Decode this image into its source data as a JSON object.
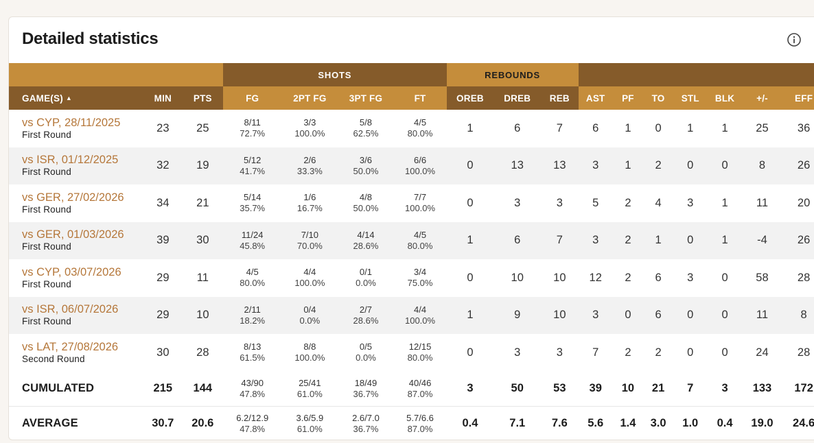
{
  "title": "Detailed statistics",
  "icons": {
    "info": "info-circle-icon",
    "sort": "sort-ascending-caret"
  },
  "colors": {
    "gold": "#c58d3b",
    "brown": "#855b2a",
    "link": "#b5773a"
  },
  "groups": {
    "shots": "SHOTS",
    "rebounds": "REBOUNDS"
  },
  "columns": {
    "game": "GAME(S)",
    "min": "MIN",
    "pts": "PTS",
    "fg": "FG",
    "fg2": "2PT FG",
    "fg3": "3PT FG",
    "ft": "FT",
    "oreb": "OREB",
    "dreb": "DREB",
    "reb": "REB",
    "ast": "AST",
    "pf": "PF",
    "to": "TO",
    "stl": "STL",
    "blk": "BLK",
    "pm": "+/-",
    "eff": "EFF"
  },
  "games": [
    {
      "game": "vs CYP, 28/11/2025",
      "round": "First Round",
      "min": "23",
      "pts": "25",
      "fg": "8/11",
      "fg_pct": "72.7%",
      "fg2": "3/3",
      "fg2_pct": "100.0%",
      "fg3": "5/8",
      "fg3_pct": "62.5%",
      "ft": "4/5",
      "ft_pct": "80.0%",
      "oreb": "1",
      "dreb": "6",
      "reb": "7",
      "ast": "6",
      "pf": "1",
      "to": "0",
      "stl": "1",
      "blk": "1",
      "pm": "25",
      "eff": "36"
    },
    {
      "game": "vs ISR, 01/12/2025",
      "round": "First Round",
      "min": "32",
      "pts": "19",
      "fg": "5/12",
      "fg_pct": "41.7%",
      "fg2": "2/6",
      "fg2_pct": "33.3%",
      "fg3": "3/6",
      "fg3_pct": "50.0%",
      "ft": "6/6",
      "ft_pct": "100.0%",
      "oreb": "0",
      "dreb": "13",
      "reb": "13",
      "ast": "3",
      "pf": "1",
      "to": "2",
      "stl": "0",
      "blk": "0",
      "pm": "8",
      "eff": "26"
    },
    {
      "game": "vs GER, 27/02/2026",
      "round": "First Round",
      "min": "34",
      "pts": "21",
      "fg": "5/14",
      "fg_pct": "35.7%",
      "fg2": "1/6",
      "fg2_pct": "16.7%",
      "fg3": "4/8",
      "fg3_pct": "50.0%",
      "ft": "7/7",
      "ft_pct": "100.0%",
      "oreb": "0",
      "dreb": "3",
      "reb": "3",
      "ast": "5",
      "pf": "2",
      "to": "4",
      "stl": "3",
      "blk": "1",
      "pm": "11",
      "eff": "20"
    },
    {
      "game": "vs GER, 01/03/2026",
      "round": "First Round",
      "min": "39",
      "pts": "30",
      "fg": "11/24",
      "fg_pct": "45.8%",
      "fg2": "7/10",
      "fg2_pct": "70.0%",
      "fg3": "4/14",
      "fg3_pct": "28.6%",
      "ft": "4/5",
      "ft_pct": "80.0%",
      "oreb": "1",
      "dreb": "6",
      "reb": "7",
      "ast": "3",
      "pf": "2",
      "to": "1",
      "stl": "0",
      "blk": "1",
      "pm": "-4",
      "eff": "26"
    },
    {
      "game": "vs CYP, 03/07/2026",
      "round": "First Round",
      "min": "29",
      "pts": "11",
      "fg": "4/5",
      "fg_pct": "80.0%",
      "fg2": "4/4",
      "fg2_pct": "100.0%",
      "fg3": "0/1",
      "fg3_pct": "0.0%",
      "ft": "3/4",
      "ft_pct": "75.0%",
      "oreb": "0",
      "dreb": "10",
      "reb": "10",
      "ast": "12",
      "pf": "2",
      "to": "6",
      "stl": "3",
      "blk": "0",
      "pm": "58",
      "eff": "28"
    },
    {
      "game": "vs ISR, 06/07/2026",
      "round": "First Round",
      "min": "29",
      "pts": "10",
      "fg": "2/11",
      "fg_pct": "18.2%",
      "fg2": "0/4",
      "fg2_pct": "0.0%",
      "fg3": "2/7",
      "fg3_pct": "28.6%",
      "ft": "4/4",
      "ft_pct": "100.0%",
      "oreb": "1",
      "dreb": "9",
      "reb": "10",
      "ast": "3",
      "pf": "0",
      "to": "6",
      "stl": "0",
      "blk": "0",
      "pm": "11",
      "eff": "8"
    },
    {
      "game": "vs LAT, 27/08/2026",
      "round": "Second Round",
      "min": "30",
      "pts": "28",
      "fg": "8/13",
      "fg_pct": "61.5%",
      "fg2": "8/8",
      "fg2_pct": "100.0%",
      "fg3": "0/5",
      "fg3_pct": "0.0%",
      "ft": "12/15",
      "ft_pct": "80.0%",
      "oreb": "0",
      "dreb": "3",
      "reb": "3",
      "ast": "7",
      "pf": "2",
      "to": "2",
      "stl": "0",
      "blk": "0",
      "pm": "24",
      "eff": "28"
    }
  ],
  "totals": {
    "cumulated": {
      "label": "CUMULATED",
      "min": "215",
      "pts": "144",
      "fg": "43/90",
      "fg_pct": "47.8%",
      "fg2": "25/41",
      "fg2_pct": "61.0%",
      "fg3": "18/49",
      "fg3_pct": "36.7%",
      "ft": "40/46",
      "ft_pct": "87.0%",
      "oreb": "3",
      "dreb": "50",
      "reb": "53",
      "ast": "39",
      "pf": "10",
      "to": "21",
      "stl": "7",
      "blk": "3",
      "pm": "133",
      "eff": "172"
    },
    "average": {
      "label": "AVERAGE",
      "min": "30.7",
      "pts": "20.6",
      "fg": "6.2/12.9",
      "fg_pct": "47.8%",
      "fg2": "3.6/5.9",
      "fg2_pct": "61.0%",
      "fg3": "2.6/7.0",
      "fg3_pct": "36.7%",
      "ft": "5.7/6.6",
      "ft_pct": "87.0%",
      "oreb": "0.4",
      "dreb": "7.1",
      "reb": "7.6",
      "ast": "5.6",
      "pf": "1.4",
      "to": "3.0",
      "stl": "1.0",
      "blk": "0.4",
      "pm": "19.0",
      "eff": "24.6"
    }
  }
}
